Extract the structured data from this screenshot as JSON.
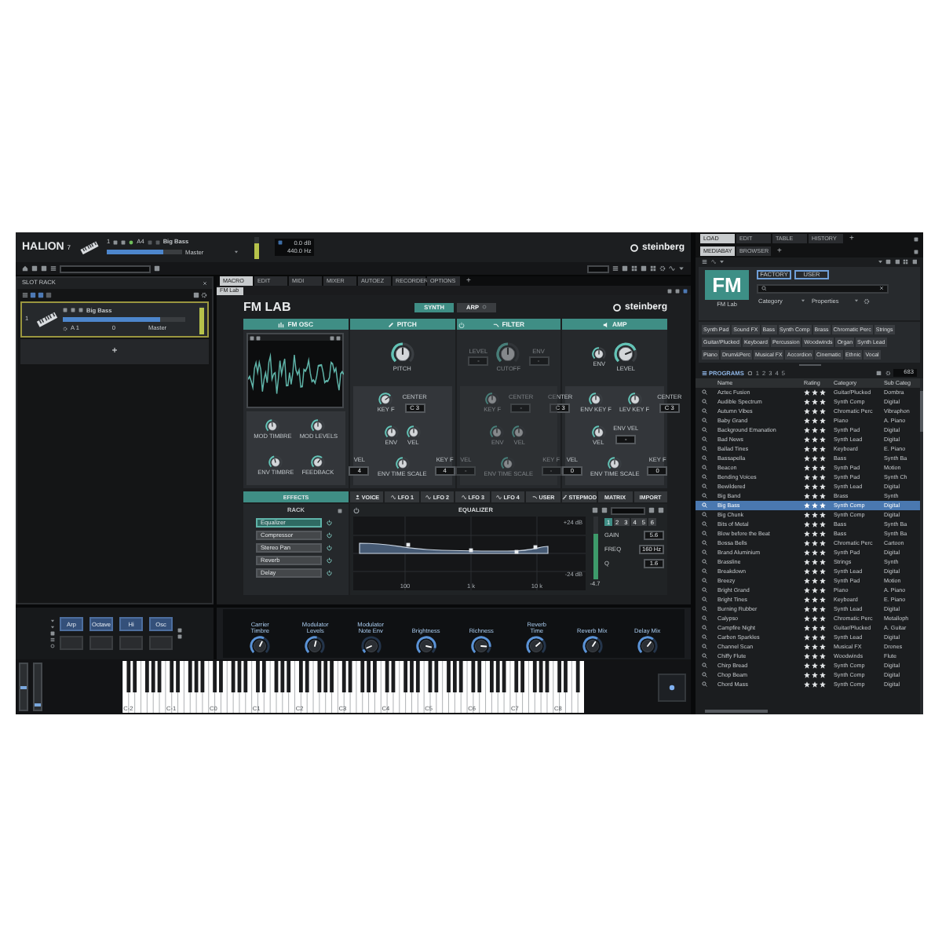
{
  "header": {
    "logo": "HALION",
    "version": "7",
    "slot_number": "1",
    "note": "A4",
    "program": "Big Bass",
    "volume": {
      "level": 0.75
    },
    "output": "Master",
    "meter": {
      "level": 0.65
    },
    "gain": "0.0 dB",
    "tuning": "440.0 Hz",
    "brand": "steinberg"
  },
  "slot_rack": {
    "title": "SLOT RACK",
    "slots": [
      {
        "number": "1",
        "program": "Big Bass",
        "channel": "A 1",
        "transpose": "0",
        "output": "Master",
        "level": 0.8,
        "meter": {
          "level": 0.9
        },
        "selected": true
      }
    ],
    "add": "+"
  },
  "center": {
    "tabs": [
      {
        "label": "MACRO",
        "selected": true
      },
      {
        "label": "EDIT",
        "selected": false
      },
      {
        "label": "MIDI",
        "selected": false
      },
      {
        "label": "MIXER",
        "selected": false
      },
      {
        "label": "AUTOEZ",
        "selected": false
      },
      {
        "label": "RECORDER",
        "selected": false
      },
      {
        "label": "OPTIONS",
        "selected": false
      }
    ],
    "add_tab": "+",
    "breadcrumb": "FM Lab"
  },
  "instrument": {
    "title": "FM LAB",
    "modes": [
      {
        "label": "SYNTH",
        "selected": true
      },
      {
        "label": "ARP",
        "selected": false,
        "on": false
      }
    ],
    "brand": "steinberg",
    "sections": [
      {
        "title": "FM OSC",
        "kind": "osc",
        "lines": [
          {
            "controls": [
              {
                "kind": "knob",
                "label": "MOD TIMBRE",
                "level": 0.48
              },
              {
                "kind": "knob",
                "label": "MOD LEVELS",
                "level": 0.5
              }
            ]
          },
          {
            "controls": [
              {
                "kind": "knob",
                "label": "ENV TIMBRE",
                "level": 0.45
              },
              {
                "kind": "knob",
                "label": "FEEDBACK",
                "level": 0.65
              }
            ]
          }
        ]
      },
      {
        "title": "PITCH",
        "kind": "pitch",
        "lines": [
          {
            "controls": [
              {
                "kind": "large_knob",
                "label": "PITCH",
                "level": 0.5
              }
            ]
          },
          {
            "controls": [
              {
                "kind": "knob",
                "label": "KEY F",
                "level": 0.7
              },
              {
                "kind": "field",
                "label": "CENTER",
                "value": "C 3"
              }
            ]
          },
          {
            "controls": [
              {
                "kind": "knob",
                "label": "ENV",
                "level": 0.5
              },
              {
                "kind": "knob",
                "label": "VEL",
                "level": 0.5
              }
            ]
          },
          {
            "controls": [
              {
                "kind": "field",
                "label": "VEL",
                "value": "4"
              },
              {
                "kind": "knob",
                "label": "ENV TIME SCALE",
                "level": 0.5
              },
              {
                "kind": "field",
                "label": "KEY F",
                "value": "4"
              }
            ]
          }
        ]
      },
      {
        "title": "FILTER",
        "kind": "filter",
        "enabled": false,
        "lines": [
          {
            "controls": [
              {
                "kind": "field",
                "label": "LEVEL",
                "value": "-"
              },
              {
                "kind": "large_knob",
                "label": "CUTOFF",
                "level": 0.5
              },
              {
                "kind": "field",
                "label": "ENV",
                "value": "-"
              }
            ]
          },
          {
            "controls": [
              {
                "kind": "knob",
                "label": "KEY F",
                "level": 0.5
              },
              {
                "kind": "field",
                "label": "CENTER",
                "value": "-"
              }
            ]
          },
          {
            "controls": [
              {
                "kind": "knob",
                "label": "ENV",
                "level": 0.5
              },
              {
                "kind": "knob",
                "label": "VEL",
                "level": 0.5
              }
            ]
          },
          {
            "controls": [
              {
                "kind": "field",
                "label": "VEL",
                "value": "-"
              },
              {
                "kind": "knob",
                "label": "ENV TIME SCALE",
                "level": 0.5
              },
              {
                "kind": "field",
                "label": "KEY F",
                "value": "-"
              }
            ]
          }
        ]
      },
      {
        "title": "AMP",
        "kind": "amp",
        "lines": [
          {
            "controls": [
              {
                "kind": "knob",
                "label": "ENV",
                "level": 0.5
              },
              {
                "kind": "large_knob",
                "label": "LEVEL",
                "level": 0.75
              }
            ]
          },
          {
            "controls": [
              {
                "kind": "field",
                "label": "CENTER",
                "value": "C 3"
              },
              {
                "kind": "knob",
                "label": "ENV KEY F",
                "level": 0.5
              },
              {
                "kind": "knob",
                "label": "LEV KEY F",
                "level": 0.5
              },
              {
                "kind": "field",
                "label": "CENTER",
                "value": "C 3"
              }
            ]
          },
          {
            "controls": [
              {
                "kind": "knob",
                "label": "VEL",
                "level": 0.5
              },
              {
                "kind": "field",
                "label": "ENV VEL",
                "value": "-"
              }
            ]
          },
          {
            "controls": [
              {
                "kind": "field",
                "label": "VEL",
                "value": "0"
              },
              {
                "kind": "knob",
                "label": "ENV TIME SCALE",
                "level": 0.5
              },
              {
                "kind": "field",
                "label": "KEY F",
                "value": "0"
              }
            ]
          }
        ]
      }
    ],
    "pages": [
      {
        "label": "EFFECTS",
        "kind": "plain",
        "selected": true
      },
      {
        "label": "VOICE",
        "kind": "voice",
        "selected": false
      },
      {
        "label": "LFO 1",
        "kind": "lfo",
        "selected": false
      },
      {
        "label": "LFO 2",
        "kind": "lfo",
        "selected": false
      },
      {
        "label": "LFO 3",
        "kind": "lfo",
        "selected": false
      },
      {
        "label": "LFO 4",
        "kind": "lfo",
        "selected": false
      },
      {
        "label": "USER",
        "kind": "user",
        "selected": false
      },
      {
        "label": "STEPMOD",
        "kind": "stepmod",
        "selected": false
      },
      {
        "label": "MATRIX",
        "kind": "plain",
        "selected": false
      },
      {
        "label": "IMPORT",
        "kind": "plain",
        "selected": false
      }
    ],
    "rack": {
      "title": "RACK",
      "items": [
        {
          "label": "Equalizer",
          "selected": true,
          "on": true
        },
        {
          "label": "Compressor",
          "selected": false,
          "on": true
        },
        {
          "label": "Stereo Pan",
          "selected": false,
          "on": true
        },
        {
          "label": "Reverb",
          "selected": false,
          "on": true
        },
        {
          "label": "Delay",
          "selected": false,
          "on": true
        }
      ]
    },
    "equalizer": {
      "title": "EQUALIZER",
      "x_labels": [
        "100",
        "1 k",
        "10 k"
      ],
      "y_labels": [
        "+24 dB",
        "-24 dB"
      ],
      "meter": {
        "level": 0.72
      },
      "meter_label": "-4.7",
      "bands": [
        {
          "label": "1",
          "selected": true
        },
        {
          "label": "2",
          "selected": false
        },
        {
          "label": "3",
          "selected": false
        },
        {
          "label": "4",
          "selected": false
        },
        {
          "label": "5",
          "selected": false
        },
        {
          "label": "6",
          "selected": false
        }
      ],
      "params": [
        {
          "label": "GAIN",
          "value": "5.6"
        },
        {
          "label": "FREQ",
          "value": "160 Hz"
        },
        {
          "label": "Q",
          "value": "1.6"
        }
      ]
    }
  },
  "pads": [
    {
      "label": "Arp",
      "on": true
    },
    {
      "label": "Octave",
      "on": true
    },
    {
      "label": "Hi",
      "on": true
    },
    {
      "label": "Osc",
      "on": true
    },
    {
      "on": false
    },
    {
      "on": false
    },
    {
      "on": false
    },
    {
      "on": false
    }
  ],
  "macros": [
    {
      "label": "Carrier Timbre",
      "level": 0.6
    },
    {
      "label": "Modulator Levels",
      "level": 0.55
    },
    {
      "label": "Modulator Note Env",
      "level": 0.08
    },
    {
      "label": "Brightness",
      "level": 0.88
    },
    {
      "label": "Richness",
      "level": 0.85
    },
    {
      "label": "Reverb Time",
      "level": 0.68
    },
    {
      "label": "Reverb Mix",
      "level": 0.62
    },
    {
      "label": "Delay Mix",
      "level": 0.64
    }
  ],
  "keyboard": {
    "labels": [
      "C-2",
      "C-1",
      "C0",
      "C1",
      "C2",
      "C3",
      "C4",
      "C5",
      "C6",
      "C7",
      "C8"
    ]
  },
  "browser": {
    "tabs": [
      {
        "label": "LOAD",
        "selected": true
      },
      {
        "label": "EDIT",
        "selected": false
      },
      {
        "label": "TABLE",
        "selected": false
      },
      {
        "label": "HISTORY",
        "selected": false
      }
    ],
    "add_tab": "+",
    "subtabs": [
      {
        "label": "MEDIABAY",
        "selected": true
      },
      {
        "label": "BROWSER",
        "selected": false
      }
    ],
    "add_subtab": "+",
    "preview": {
      "tile": "FM",
      "name": "FM Lab"
    },
    "sources": [
      {
        "label": "FACTORY",
        "selected": true
      },
      {
        "label": "USER",
        "selected": true
      }
    ],
    "dropdowns": [
      "Category",
      "Properties"
    ],
    "tag_rows": [
      [
        "Synth Pad",
        "Sound FX",
        "Bass",
        "Synth Comp",
        "Brass",
        "Chromatic Perc",
        "Strings"
      ],
      [
        "Guitar/Plucked",
        "Keyboard",
        "Percussion",
        "Woodwinds",
        "Organ",
        "Synth Lead"
      ],
      [
        "Piano",
        "Drum&Perc",
        "Musical FX",
        "Accordion",
        "Cinematic",
        "Ethnic",
        "Vocal"
      ]
    ],
    "results": {
      "label": "PROGRAMS",
      "rating_filter": [
        "1",
        "2",
        "3",
        "4",
        "5"
      ],
      "count": "683",
      "columns": [
        "Name",
        "Rating",
        "Category",
        "Sub Categ"
      ],
      "rows": [
        {
          "name": "Aztec Fusion",
          "stars": 3,
          "category": "Guitar/Plucked",
          "subcategory": "Dombra",
          "selected": false
        },
        {
          "name": "Audible Spectrum",
          "stars": 3,
          "category": "Synth Comp",
          "subcategory": "Digital",
          "selected": false
        },
        {
          "name": "Autumn Vibes",
          "stars": 3,
          "category": "Chromatic Perc",
          "subcategory": "Vibraphon",
          "selected": false
        },
        {
          "name": "Baby Grand",
          "stars": 3,
          "category": "Piano",
          "subcategory": "A. Piano",
          "selected": false
        },
        {
          "name": "Background Emanation",
          "stars": 3,
          "category": "Synth Pad",
          "subcategory": "Digital",
          "selected": false
        },
        {
          "name": "Bad News",
          "stars": 3,
          "category": "Synth Lead",
          "subcategory": "Digital",
          "selected": false
        },
        {
          "name": "Ballad Tines",
          "stars": 3,
          "category": "Keyboard",
          "subcategory": "E. Piano",
          "selected": false
        },
        {
          "name": "Bassapella",
          "stars": 3,
          "category": "Bass",
          "subcategory": "Synth Ba",
          "selected": false
        },
        {
          "name": "Beacon",
          "stars": 3,
          "category": "Synth Pad",
          "subcategory": "Motion",
          "selected": false
        },
        {
          "name": "Bending Voices",
          "stars": 3,
          "category": "Synth Pad",
          "subcategory": "Synth Ch",
          "selected": false
        },
        {
          "name": "Bewildered",
          "stars": 3,
          "category": "Synth Lead",
          "subcategory": "Digital",
          "selected": false
        },
        {
          "name": "Big Band",
          "stars": 3,
          "category": "Brass",
          "subcategory": "Synth",
          "selected": false
        },
        {
          "name": "Big Bass",
          "stars": 3,
          "category": "Synth Comp",
          "subcategory": "Digital",
          "selected": true
        },
        {
          "name": "Big Chunk",
          "stars": 3,
          "category": "Synth Comp",
          "subcategory": "Digital",
          "selected": false
        },
        {
          "name": "Bits of Metal",
          "stars": 3,
          "category": "Bass",
          "subcategory": "Synth Ba",
          "selected": false
        },
        {
          "name": "Blow before the Beat",
          "stars": 3,
          "category": "Bass",
          "subcategory": "Synth Ba",
          "selected": false
        },
        {
          "name": "Bossa Bells",
          "stars": 3,
          "category": "Chromatic Perc",
          "subcategory": "Cartoon",
          "selected": false
        },
        {
          "name": "Brand Aluminium",
          "stars": 3,
          "category": "Synth Pad",
          "subcategory": "Digital",
          "selected": false
        },
        {
          "name": "Brassline",
          "stars": 3,
          "category": "Strings",
          "subcategory": "Synth",
          "selected": false
        },
        {
          "name": "Breakdown",
          "stars": 3,
          "category": "Synth Lead",
          "subcategory": "Digital",
          "selected": false
        },
        {
          "name": "Breezy",
          "stars": 3,
          "category": "Synth Pad",
          "subcategory": "Motion",
          "selected": false
        },
        {
          "name": "Bright Grand",
          "stars": 3,
          "category": "Piano",
          "subcategory": "A. Piano",
          "selected": false
        },
        {
          "name": "Bright Tines",
          "stars": 3,
          "category": "Keyboard",
          "subcategory": "E. Piano",
          "selected": false
        },
        {
          "name": "Burning Rubber",
          "stars": 3,
          "category": "Synth Lead",
          "subcategory": "Digital",
          "selected": false
        },
        {
          "name": "Calypso",
          "stars": 3,
          "category": "Chromatic Perc",
          "subcategory": "Metalloph",
          "selected": false
        },
        {
          "name": "Campfire Night",
          "stars": 3,
          "category": "Guitar/Plucked",
          "subcategory": "A. Guitar",
          "selected": false
        },
        {
          "name": "Carbon Sparkles",
          "stars": 3,
          "category": "Synth Lead",
          "subcategory": "Digital",
          "selected": false
        },
        {
          "name": "Channel Scan",
          "stars": 3,
          "category": "Musical FX",
          "subcategory": "Drones",
          "selected": false
        },
        {
          "name": "Chiffy Flute",
          "stars": 3,
          "category": "Woodwinds",
          "subcategory": "Flute",
          "selected": false
        },
        {
          "name": "Chirp Bread",
          "stars": 3,
          "category": "Synth Comp",
          "subcategory": "Digital",
          "selected": false
        },
        {
          "name": "Chop Beam",
          "stars": 3,
          "category": "Synth Comp",
          "subcategory": "Digital",
          "selected": false
        },
        {
          "name": "Chord Mass",
          "stars": 3,
          "category": "Synth Comp",
          "subcategory": "Digital",
          "selected": false
        }
      ]
    }
  }
}
